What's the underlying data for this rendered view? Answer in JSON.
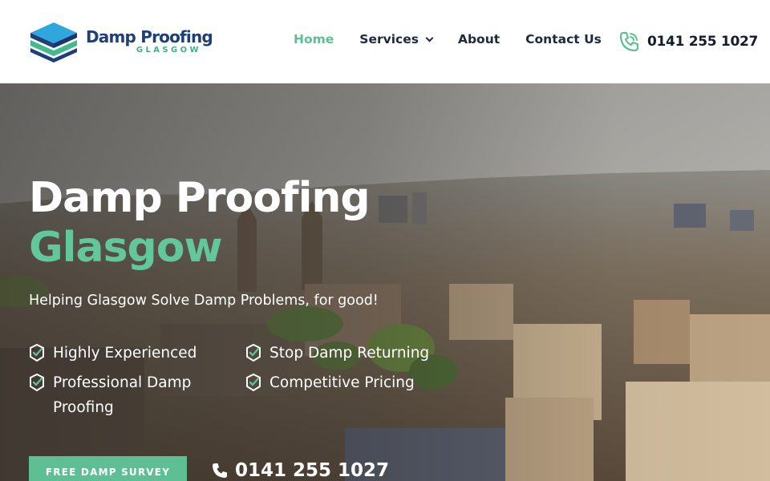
{
  "brand": {
    "name": "Damp Proofing",
    "location": "GLASGOW",
    "colors": {
      "navy": "#1f3f7a",
      "green": "#5fbf94",
      "accent_text": "#62c79a"
    }
  },
  "nav": {
    "items": [
      {
        "label": "Home",
        "active": true
      },
      {
        "label": "Services",
        "has_dropdown": true
      },
      {
        "label": "About"
      },
      {
        "label": "Contact Us"
      }
    ]
  },
  "header_phone": {
    "icon": "phone-icon",
    "number": "0141 255 1027"
  },
  "hero": {
    "title": "Damp Proofing",
    "title_accent": "Glasgow",
    "subtitle": "Helping Glasgow Solve Damp Problems, for good!",
    "features": [
      {
        "label": "Highly Experienced",
        "icon": "shield-check-icon"
      },
      {
        "label": "Stop Damp Returning",
        "icon": "shield-check-icon"
      },
      {
        "label": "Professional Damp Proofing",
        "icon": "shield-check-icon"
      },
      {
        "label": "Competitive Pricing",
        "icon": "shield-check-icon"
      }
    ],
    "cta_label": "FREE DAMP SURVEY",
    "phone": {
      "icon": "phone-icon",
      "number": "0141 255 1027"
    }
  }
}
